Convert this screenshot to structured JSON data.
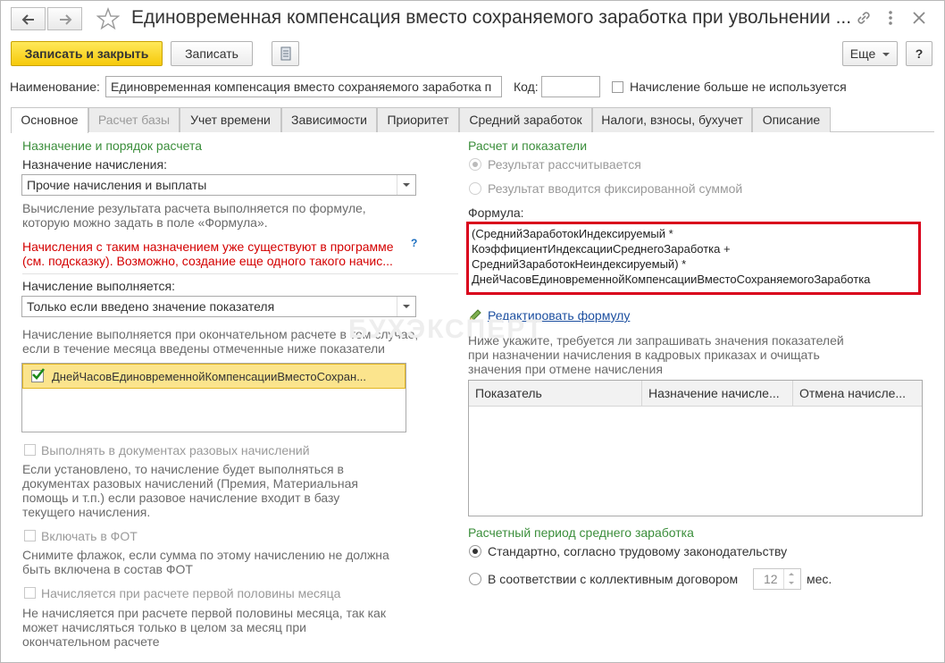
{
  "window": {
    "title": "Единовременная компенсация вместо сохраняемого заработка при увольнении ...",
    "back_icon": "arrow-left",
    "forward_icon": "arrow-right",
    "favorite_icon": "star",
    "link_icon": "link",
    "menu_icon": "more-vertical",
    "close_icon": "close"
  },
  "toolbar": {
    "save_close_label": "Записать и закрыть",
    "save_label": "Записать",
    "more_label": "Еще",
    "help_label": "?"
  },
  "header": {
    "name_label": "Наименование:",
    "name_value": "Единовременная компенсация вместо сохраняемого заработка п",
    "code_label": "Код:",
    "code_value": "",
    "unused_label": "Начисление больше не используется"
  },
  "tabs": [
    {
      "label": "Основное"
    },
    {
      "label": "Расчет базы"
    },
    {
      "label": "Учет времени"
    },
    {
      "label": "Зависимости"
    },
    {
      "label": "Приоритет"
    },
    {
      "label": "Средний заработок"
    },
    {
      "label": "Налоги, взносы, бухучет"
    },
    {
      "label": "Описание"
    }
  ],
  "left": {
    "section_title": "Назначение и порядок расчета",
    "purpose_label": "Назначение начисления:",
    "purpose_value": "Прочие начисления и выплаты",
    "purpose_hint": "Вычисление результата расчета выполняется по формуле,\nкоторую можно задать в поле «Формула».",
    "warning_line1": "Начисления с таким назначением уже существуют в программе",
    "warning_line2": "(см. подсказку). Возможно, создание еще одного такого начис...",
    "warning_help": "?",
    "performed_label": "Начисление выполняется:",
    "performed_value": "Только если введено значение показателя",
    "performed_hint": "Начисление выполняется при окончательном расчете в том случае,\nесли в течение месяца введены отмеченные ниже показатели",
    "indicator_item": "ДнейЧасовЕдиновременнойКомпенсацииВместоСохран...",
    "one_time_label": "Выполнять в документах разовых начислений",
    "one_time_hint": "Если установлено, то начисление будет выполняться в\nдокументах разовых начислений (Премия, Материальная\nпомощь и т.п.) если разовое начисление входит в базу\nтекущего начисления.",
    "fot_label": "Включать в ФОТ",
    "fot_hint": "Снимите флажок, если сумма по этому начислению не должна\nбыть включена в состав ФОТ",
    "first_half_label": "Начисляется при расчете первой половины месяца",
    "first_half_hint": "Не начисляется при расчете первой половины месяца, так как\nможет начисляться только в целом за месяц при\nокончательном расчете"
  },
  "right": {
    "section_title": "Расчет и показатели",
    "radio_calculated": "Результат рассчитывается",
    "radio_fixed": "Результат вводится фиксированной суммой",
    "formula_label": "Формула:",
    "formula_text": "(СреднийЗаработокИндексируемый *\nКоэффициентИндексацииСреднегоЗаработка +\nСреднийЗаработокНеиндексируемый) *\nДнейЧасовЕдиновременнойКомпенсацииВместоСохраняемогоЗаработка",
    "edit_formula_link": "Редактировать формулу",
    "indicators_hint": "Ниже укажите, требуется ли запрашивать значения показателей\nпри назначении начисления в кадровых приказах и очищать\nзначения при отмене начисления",
    "table_columns": [
      "Показатель",
      "Назначение начисле...",
      "Отмена начисле..."
    ],
    "period_title": "Расчетный период среднего заработка",
    "period_standard": "Стандартно, согласно трудовому законодательству",
    "period_collective": "В соответствии с коллективным договором",
    "months_value": "12",
    "months_unit": "мес."
  },
  "watermark": "БУХЭКСПЕРТ",
  "colors": {
    "accent_yellow": "#f6c90a",
    "section_green": "#3b8e3b",
    "warning_red": "#d40000",
    "highlight_border": "#d9001b",
    "link_blue": "#1c4fa0"
  }
}
